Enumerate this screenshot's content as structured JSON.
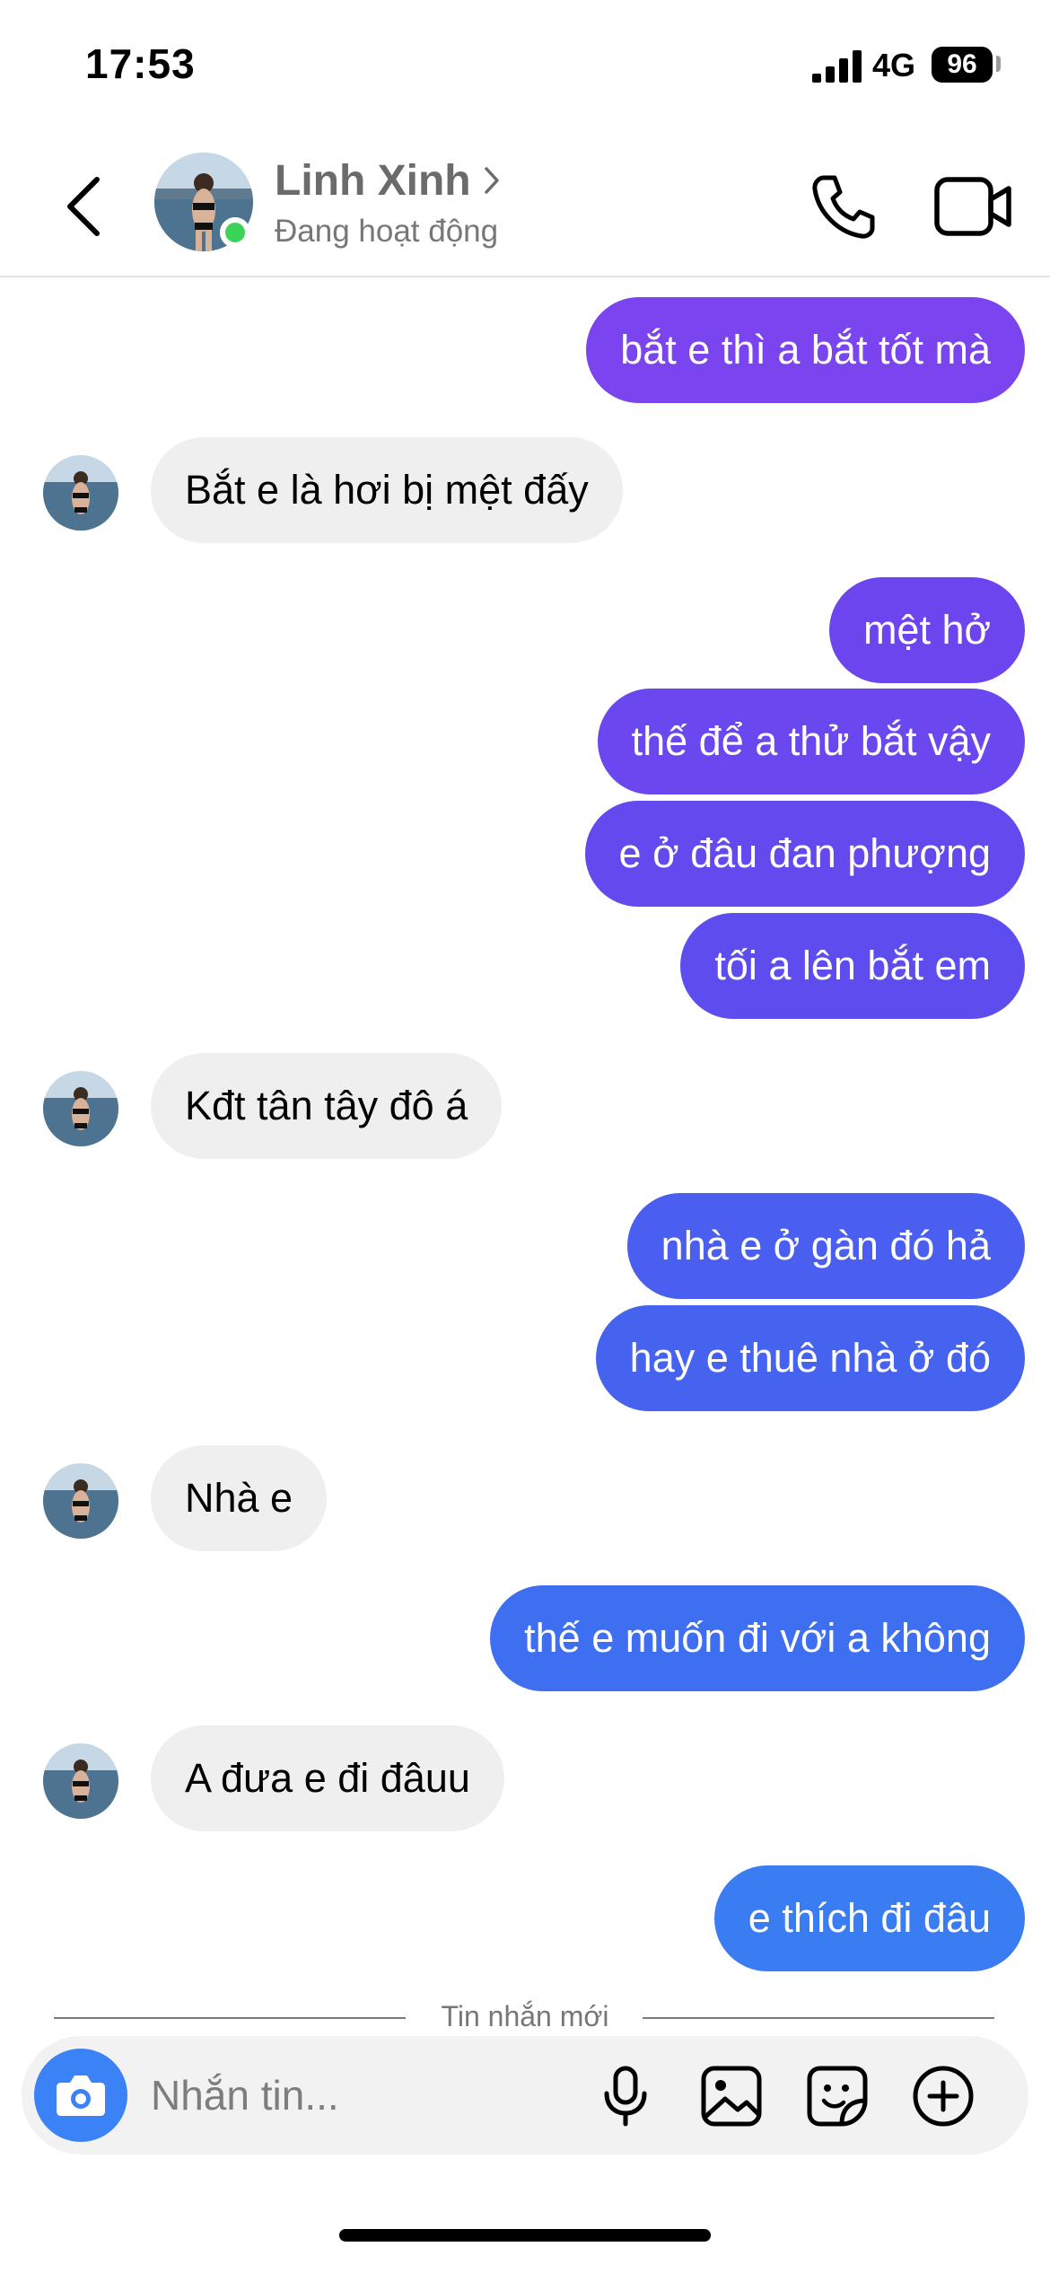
{
  "status_bar": {
    "time": "17:53",
    "network": "4G",
    "battery": "96"
  },
  "header": {
    "name": "Linh Xinh",
    "status": "Đang hoạt động"
  },
  "messages": [
    {
      "side": "sent",
      "text": "bắt e thì a bắt tốt mà",
      "color": "#7a44ef"
    },
    {
      "side": "received",
      "text": "Bắt e là hơi bị mệt đấy"
    },
    {
      "side": "sent",
      "text": "mệt hở",
      "color": "#6d45ef"
    },
    {
      "side": "sent",
      "text": "thế để a thử bắt vậy",
      "color": "#6a47ee"
    },
    {
      "side": "sent",
      "text": "e ở đâu đan phượng",
      "color": "#6349ee"
    },
    {
      "side": "sent",
      "text": "tối a lên bắt em",
      "color": "#5d4cee"
    },
    {
      "side": "received",
      "text": "Kđt tân tây đô á"
    },
    {
      "side": "sent",
      "text": "nhà e ở gàn đó hả",
      "color": "#4a5eef"
    },
    {
      "side": "sent",
      "text": "hay e thuê nhà ở đó",
      "color": "#4663ef"
    },
    {
      "side": "received",
      "text": "Nhà e"
    },
    {
      "side": "sent",
      "text": "thế e muốn đi với a không",
      "color": "#3e6ff0"
    },
    {
      "side": "received",
      "text": "A đưa e đi đâuu"
    },
    {
      "side": "sent",
      "text": "e thích đi đâu",
      "color": "#3a7cf2"
    }
  ],
  "divider": {
    "label": "Tin nhắn mới"
  },
  "composer": {
    "placeholder": "Nhắn tin..."
  },
  "icons": [
    "back-icon",
    "chevron-right-icon",
    "phone-icon",
    "video-camera-icon",
    "camera-icon",
    "microphone-icon",
    "image-icon",
    "sticker-icon",
    "plus-circle-icon"
  ]
}
